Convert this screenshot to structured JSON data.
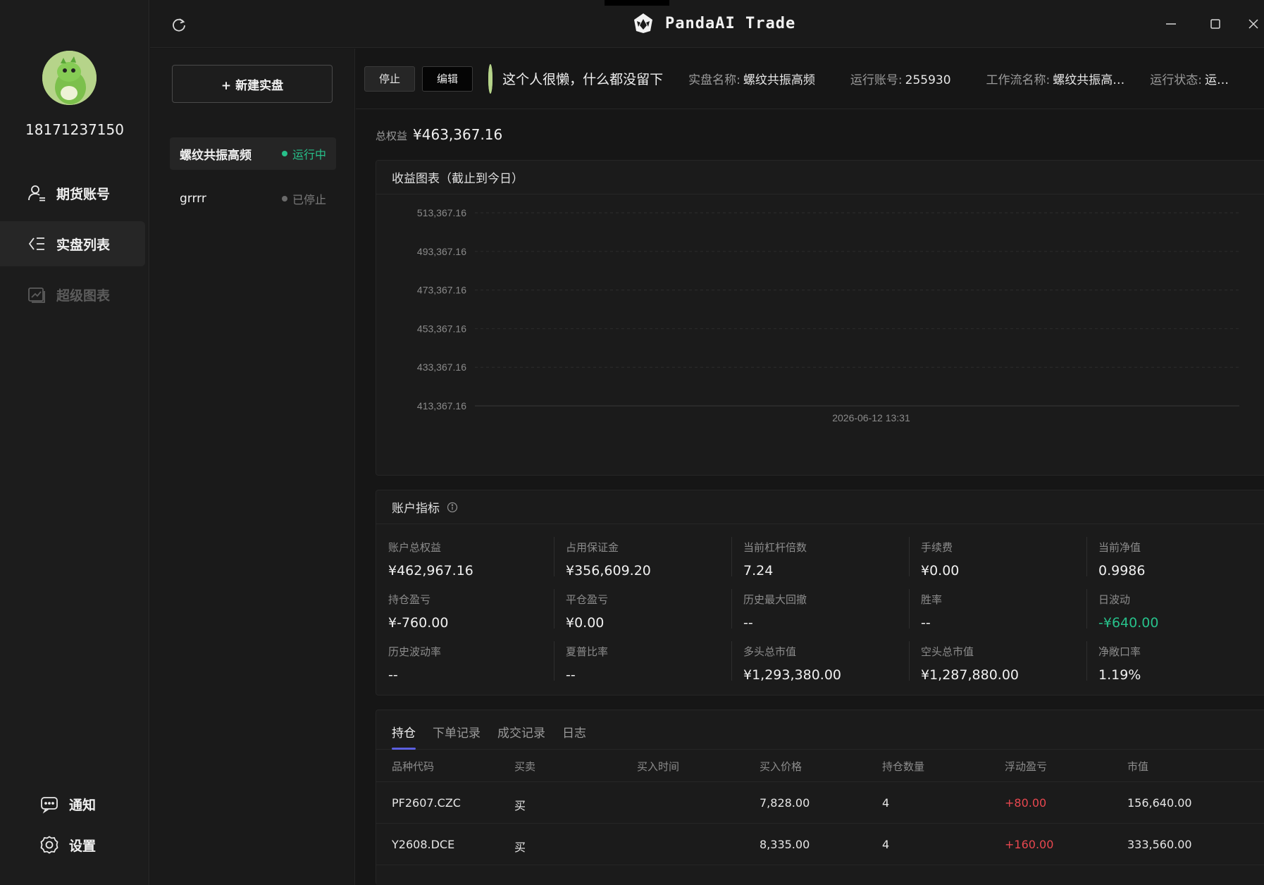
{
  "user": {
    "phone": "18171237150"
  },
  "nav": {
    "items": [
      {
        "label": "期货账号",
        "icon": "user-icon"
      },
      {
        "label": "实盘列表",
        "icon": "list-icon"
      },
      {
        "label": "超级图表",
        "icon": "chart-icon"
      }
    ],
    "bottom": [
      {
        "label": "通知",
        "icon": "message-icon"
      },
      {
        "label": "设置",
        "icon": "gear-icon"
      }
    ]
  },
  "titlebar": {
    "title": "PandaAI Trade"
  },
  "list": {
    "new_button": "+ 新建实盘",
    "strategies": [
      {
        "name": "螺纹共振高频",
        "status": "运行中",
        "status_color": "#27c08a"
      },
      {
        "name": "grrrr",
        "status": "已停止",
        "status_color": "#7a7a7a"
      }
    ]
  },
  "header": {
    "stop_button": "停止",
    "edit_button": "编辑",
    "motto": "这个人很懒，什么都没留下",
    "name_label": "实盘名称:",
    "name_value": "螺纹共振高频",
    "account_label": "运行账号:",
    "account_value": "255930",
    "workflow_label": "工作流名称:",
    "workflow_value": "螺纹共振高…",
    "state_label": "运行状态:",
    "state_value": "运…"
  },
  "equity": {
    "label": "总权益",
    "value": "¥463,367.16"
  },
  "chart": {
    "title": "收益图表（截止到今日）"
  },
  "chart_data": {
    "type": "line",
    "y_ticks": [
      "513,367.16",
      "493,367.16",
      "473,367.16",
      "453,367.16",
      "433,367.16",
      "413,367.16"
    ],
    "x_ticks": [
      "2026-06-12 13:31"
    ],
    "ylim": [
      413367.16,
      513367.16
    ],
    "grid": true,
    "series": []
  },
  "metrics": {
    "title": "账户指标",
    "items": [
      {
        "label": "账户总权益",
        "value": "¥462,967.16"
      },
      {
        "label": "占用保证金",
        "value": "¥356,609.20"
      },
      {
        "label": "当前杠杆倍数",
        "value": "7.24"
      },
      {
        "label": "手续费",
        "value": "¥0.00"
      },
      {
        "label": "当前净值",
        "value": "0.9986"
      },
      {
        "label": "持仓盈亏",
        "value": "¥-760.00"
      },
      {
        "label": "平仓盈亏",
        "value": "¥0.00"
      },
      {
        "label": "历史最大回撤",
        "value": "--"
      },
      {
        "label": "胜率",
        "value": "--"
      },
      {
        "label": "日波动",
        "value": "-¥640.00",
        "tone": "green"
      },
      {
        "label": "历史波动率",
        "value": "--"
      },
      {
        "label": "夏普比率",
        "value": "--"
      },
      {
        "label": "多头总市值",
        "value": "¥1,293,380.00"
      },
      {
        "label": "空头总市值",
        "value": "¥1,287,880.00"
      },
      {
        "label": "净敞口率",
        "value": "1.19%"
      }
    ]
  },
  "tabs": [
    "持仓",
    "下单记录",
    "成交记录",
    "日志"
  ],
  "table": {
    "columns": [
      "品种代码",
      "买卖",
      "买入时间",
      "买入价格",
      "持仓数量",
      "浮动盈亏",
      "市值"
    ],
    "rows": [
      [
        "PF2607.CZC",
        "买",
        "",
        "7,828.00",
        "4",
        "+80.00",
        "156,640.00"
      ],
      [
        "Y2608.DCE",
        "买",
        "",
        "8,335.00",
        "4",
        "+160.00",
        "333,560.00"
      ]
    ]
  },
  "colors": {
    "accent": "#5b5fe0",
    "profit": "#e8474f",
    "loss": "#27c08a"
  }
}
